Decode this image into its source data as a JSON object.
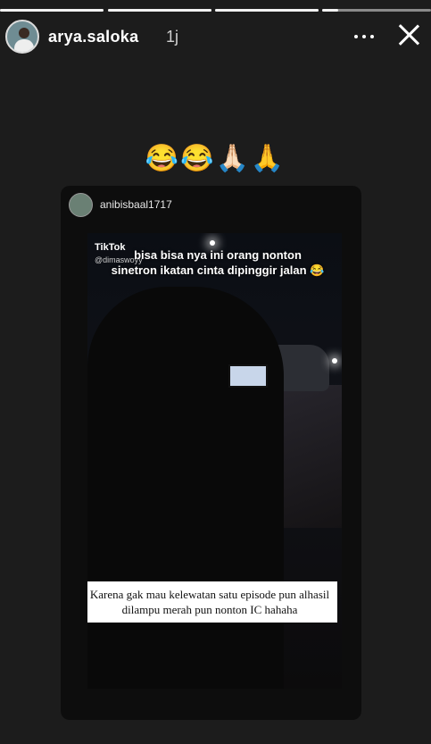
{
  "progress": {
    "segments": 4,
    "current_segment": 4,
    "current_fill_fraction": 0.15
  },
  "header": {
    "username": "arya.saloka",
    "time": "1j"
  },
  "emojis": "😂😂🙏🏻🙏",
  "repost": {
    "username": "anibisbaal1717",
    "video": {
      "watermark": "TikTok",
      "handle": "@dimaswoyy",
      "caption": "bisa bisa nya ini orang nonton sinetron ikatan cinta dipinggir jalan 😂",
      "subtitle": "Karena gak mau kelewatan satu episode pun alhasil dilampu merah pun nonton IC hahaha"
    }
  }
}
